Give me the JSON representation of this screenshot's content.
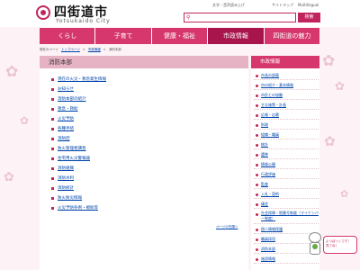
{
  "header": {
    "logo_name": "四街道市",
    "logo_sub": "Yotsukaido City",
    "util_links": [
      "文字・音声読み上げ",
      "サイトマップ",
      "Multilingual"
    ],
    "search": {
      "placeholder": "",
      "button_label": "検索"
    }
  },
  "nav": {
    "items": [
      {
        "label": "くらし"
      },
      {
        "label": "子育て"
      },
      {
        "label": "健康・福祉"
      },
      {
        "label": "市政情報"
      },
      {
        "label": "四街道の魅力"
      }
    ]
  },
  "breadcrumb": [
    "現在のページ",
    "トップページ",
    "市政情報",
    "消防本部"
  ],
  "main": {
    "title": "消防本部",
    "items": [
      "現在の火災・救急発生情報",
      "お知らせ",
      "消防本部の紹介",
      "救急・救助",
      "火災予防",
      "各種手続",
      "消防団",
      "防火管理者講習",
      "住宅用火災警報器",
      "消防組織",
      "消防水利",
      "消防統計",
      "防火防災情報",
      "火災予防条例・規則等"
    ],
    "back_to_top": "ページの先頭へ"
  },
  "sidebar": {
    "title": "市政情報",
    "items": [
      {
        "label": "市長の部屋"
      },
      {
        "label": "市の紹介・基本情報"
      },
      {
        "label": "市民との協働"
      },
      {
        "label": "主な施策・計画"
      },
      {
        "label": "広報・広聴"
      },
      {
        "label": "財政"
      },
      {
        "label": "組織・職員"
      },
      {
        "label": "統計"
      },
      {
        "label": "選挙"
      },
      {
        "label": "情報公開"
      },
      {
        "label": "行政評価"
      },
      {
        "label": "監査"
      },
      {
        "label": "入札・契約"
      },
      {
        "label": "議会"
      },
      {
        "label": "社会保障・税番号制度（マイナンバー制度）",
        "tall": true
      },
      {
        "label": "個人情報保護"
      },
      {
        "label": "職員採用"
      },
      {
        "label": "消防本部"
      },
      {
        "label": "施設情報"
      }
    ]
  },
  "mascot": {
    "bubble": "よつぼっくです！ 見てね！"
  }
}
